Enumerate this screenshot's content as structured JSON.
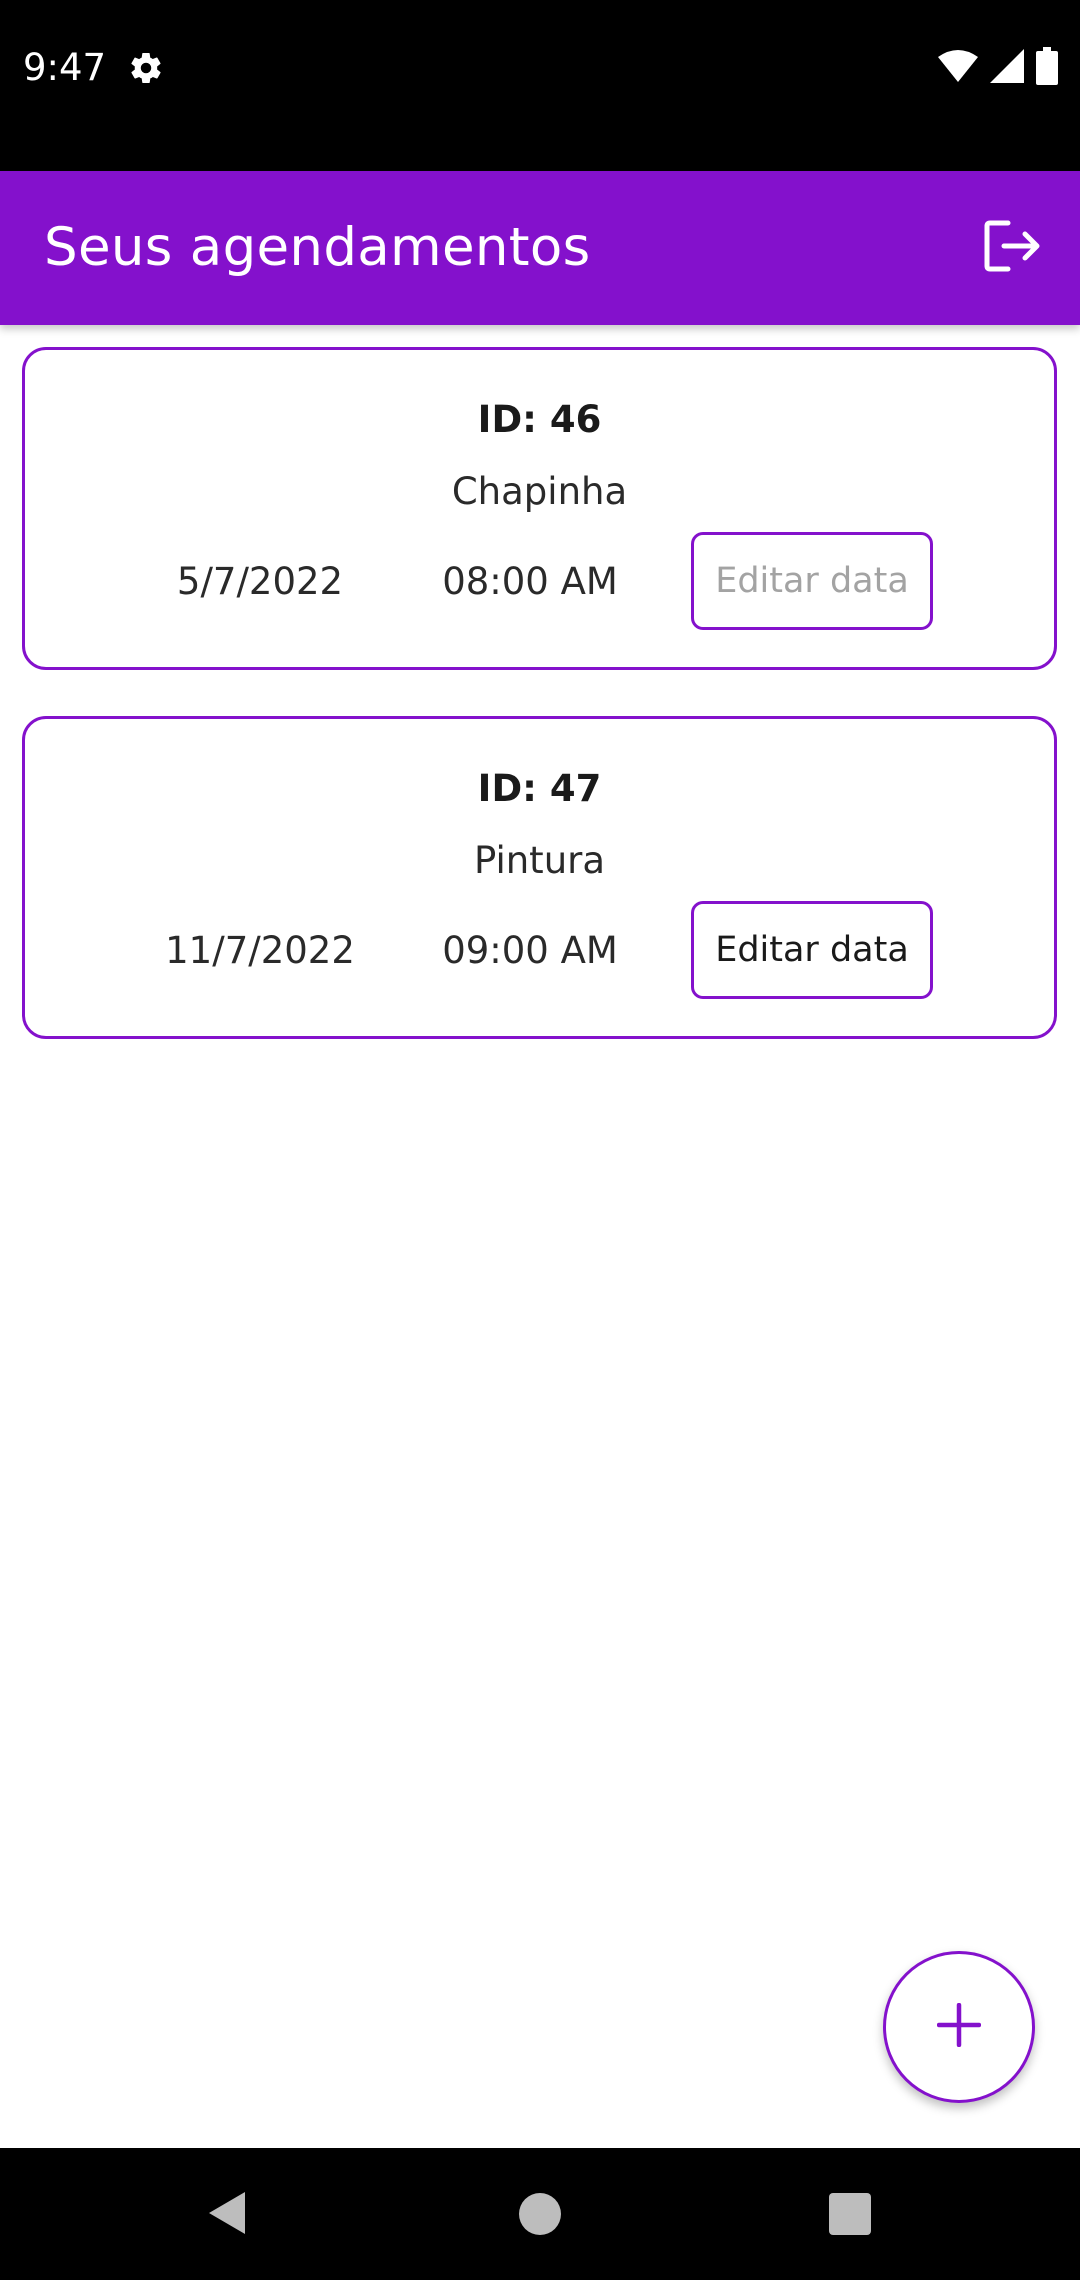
{
  "status_bar": {
    "time": "9:47",
    "icons": [
      "gear-icon",
      "wifi-icon",
      "signal-icon",
      "battery-icon"
    ]
  },
  "app_bar": {
    "title": "Seus agendamentos",
    "logout_icon": "logout-icon",
    "background": "#8411cc"
  },
  "appointments": [
    {
      "id_label": "ID: 46",
      "service": "Chapinha",
      "date": "5/7/2022",
      "time": "08:00 AM",
      "edit_label": "Editar data",
      "edit_enabled": false
    },
    {
      "id_label": "ID: 47",
      "service": "Pintura",
      "date": "11/7/2022",
      "time": "09:00 AM",
      "edit_label": "Editar data",
      "edit_enabled": true
    }
  ],
  "fab": {
    "icon": "plus-icon"
  },
  "nav_bar": {
    "icons": [
      "back-icon",
      "home-icon",
      "recents-icon"
    ]
  },
  "colors": {
    "accent": "#8411cc",
    "disabled_text": "#a3a3a3"
  }
}
